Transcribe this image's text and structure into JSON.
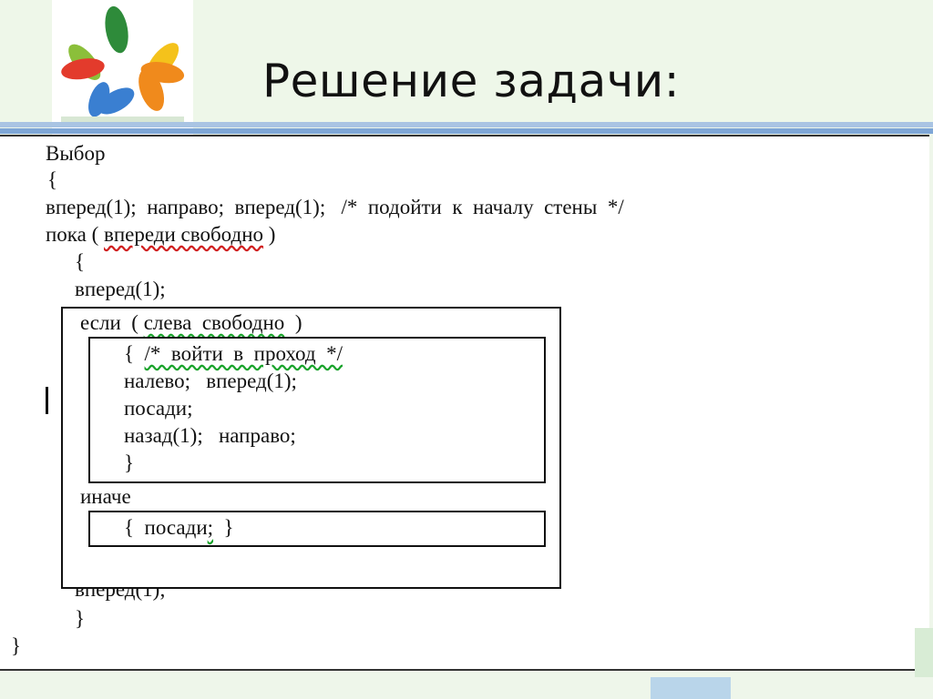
{
  "slide": {
    "title": "Решение задачи:",
    "logo_icon": "colorful-hands-logo"
  },
  "code": {
    "line1": "Выбор",
    "line2": "{",
    "line3": "вперед(1);  направо;  вперед(1);   /*  подойти  к  началу  стены  */",
    "line4_pre": "пока ( ",
    "line4_cond": "впереди свободно",
    "line4_post": " )",
    "line5": "{",
    "line6": "вперед(1);",
    "if_line_pre": "если  ( ",
    "if_cond": "слева  свободно",
    "if_post": "  )",
    "inner1_pre": "{  ",
    "inner1_comment": "/*  войти  в  проход  */",
    "inner2": "налево;   вперед(1);",
    "inner3": "посади;",
    "inner4": "назад(1);   направо;",
    "inner5": "}",
    "else_line": "иначе",
    "else_body_pre": "{  посади",
    "else_body_semi": ";",
    "else_body_post": "  }",
    "partial_line": "вперед(1);",
    "close_inner": "}",
    "close_outer": "}"
  }
}
